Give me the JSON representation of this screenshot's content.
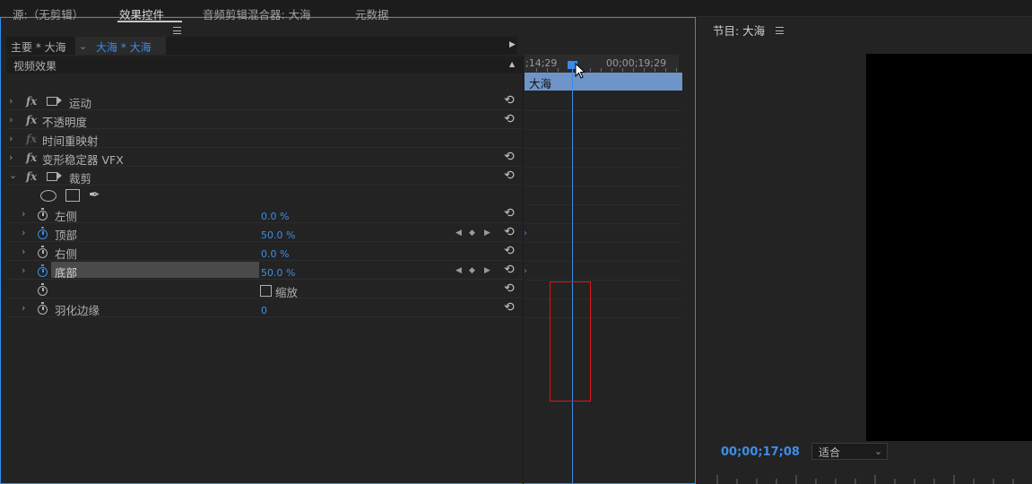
{
  "tabs": [
    {
      "label": "源:（无剪辑）"
    },
    {
      "label": "效果控件"
    },
    {
      "label": "音频剪辑混合器: 大海"
    },
    {
      "label": "元数据"
    }
  ],
  "clip_selector": {
    "master": "主要 * 大海",
    "sequence": "大海 * 大海"
  },
  "video_effects_header": "视频效果",
  "effects": {
    "motion": "运动",
    "opacity": "不透明度",
    "time_remap": "时间重映射",
    "warp_stabilizer": "变形稳定器 VFX",
    "crop": "裁剪"
  },
  "crop_params": {
    "left": {
      "label": "左侧",
      "value": "0.0 %"
    },
    "top": {
      "label": "顶部",
      "value": "50.0 %"
    },
    "right": {
      "label": "右侧",
      "value": "0.0 %"
    },
    "bottom": {
      "label": "底部",
      "value": "50.0 %"
    },
    "zoom_label": "缩放",
    "feather": {
      "label": "羽化边缘",
      "value": "0"
    }
  },
  "timeline": {
    "ruler_left": ";14;29",
    "ruler_right": "00;00;19;29",
    "clip_name": "大海"
  },
  "program_monitor": {
    "title": "节目: 大海",
    "timecode": "00;00;17;08",
    "fit": "适合"
  },
  "colors": {
    "accent_blue": "#2d8ceb",
    "value_blue": "#3d8ee8",
    "clip_blue": "#6f95c8",
    "annotation_red": "#e3131a"
  }
}
